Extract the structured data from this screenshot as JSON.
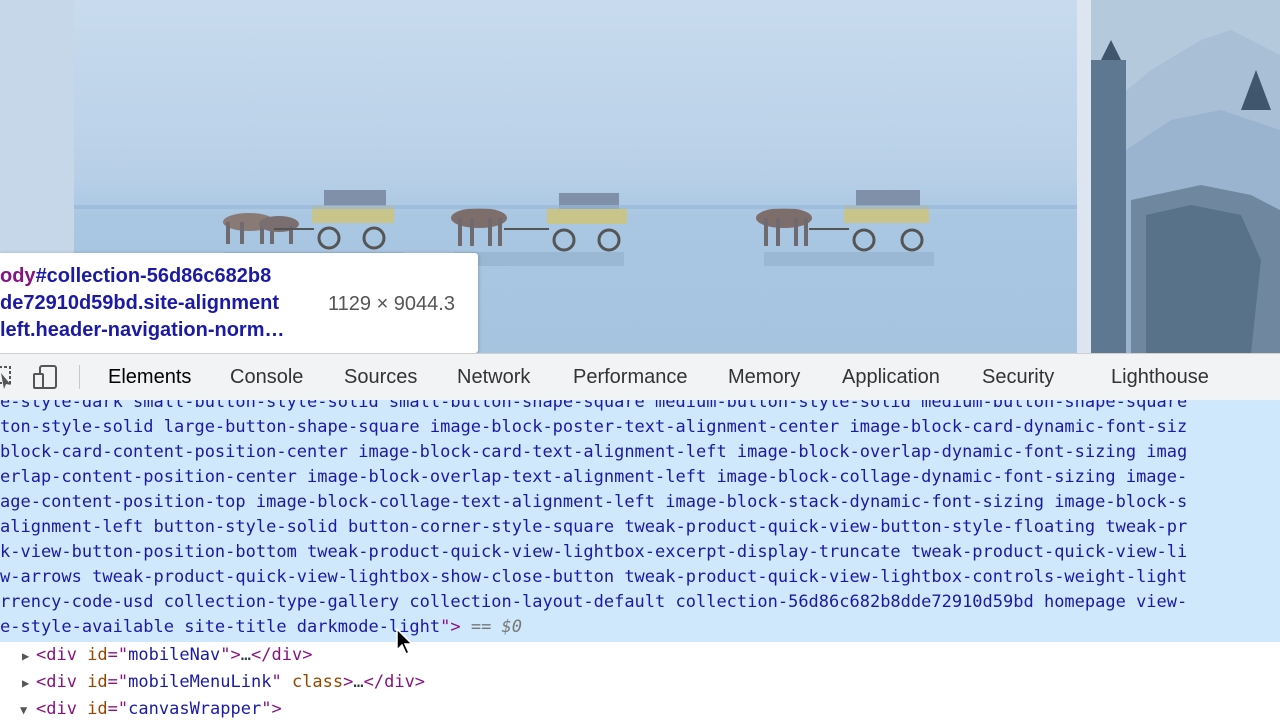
{
  "tooltip": {
    "line1_tag": "ody",
    "line1_rest": "#collection-56d86c682b8",
    "line2": "de72910d59bd.site-alignment",
    "line3": "left.header-navigation-norm…",
    "size": "1129 × 9044.3"
  },
  "devtools": {
    "tabs": [
      "Elements",
      "Console",
      "Sources",
      "Network",
      "Performance",
      "Memory",
      "Application",
      "Security",
      "Lighthouse"
    ],
    "active_tab": "Elements",
    "icons": [
      "inspect-cursor-icon",
      "device-toolbar-icon"
    ]
  },
  "code": {
    "class_lines": [
      "e-style-dark small-button-style-solid small-button-shape-square medium-button-style-solid medium-button-shape-square",
      "ton-style-solid large-button-shape-square image-block-poster-text-alignment-center image-block-card-dynamic-font-siz",
      "block-card-content-position-center image-block-card-text-alignment-left image-block-overlap-dynamic-font-sizing imag",
      "erlap-content-position-center image-block-overlap-text-alignment-left image-block-collage-dynamic-font-sizing image-",
      "age-content-position-top image-block-collage-text-alignment-left image-block-stack-dynamic-font-sizing image-block-s",
      "alignment-left button-style-solid button-corner-style-square tweak-product-quick-view-button-style-floating tweak-pr",
      "k-view-button-position-bottom tweak-product-quick-view-lightbox-excerpt-display-truncate tweak-product-quick-view-li",
      "w-arrows tweak-product-quick-view-lightbox-show-close-button tweak-product-quick-view-lightbox-controls-weight-light",
      "rrency-code-usd collection-type-gallery collection-layout-default collection-56d86c682b8dde72910d59bd homepage view-"
    ],
    "last_line_text": "e-style-available site-title darkmode-light",
    "last_line_close": "\">",
    "eq_marker": " == ",
    "dollar": "$0",
    "nodes": [
      {
        "open": "<div ",
        "attr1": "id",
        "eq1": "=\"",
        "val1": "mobileNav",
        "close1": "\">",
        "ellipsis": "…",
        "end": "</div>"
      },
      {
        "open": "<div ",
        "attr1": "id",
        "eq1": "=\"",
        "val1": "mobileMenuLink",
        "close1": "\" ",
        "attr2": "class",
        "close2": ">",
        "ellipsis": "…",
        "end": "</div>"
      },
      {
        "open": "<div ",
        "attr1": "id",
        "eq1": "=\"",
        "val1": "canvasWrapper",
        "close1": "\">"
      }
    ]
  },
  "colors": {
    "selection": "#cfe8fc",
    "tag": "#881280",
    "attr": "#994500",
    "value": "#1a1aa6",
    "preview_overlay": "#a6c4e0"
  }
}
